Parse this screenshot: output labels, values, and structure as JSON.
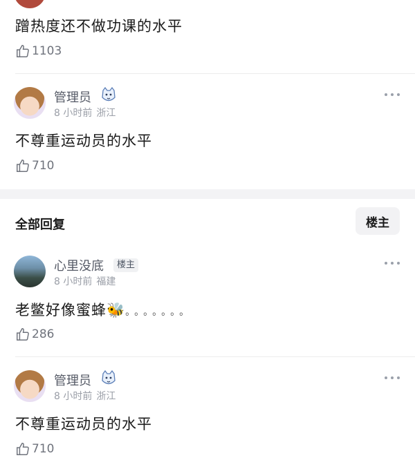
{
  "top_comment_partial": {
    "text": "蹭热度还不做功课的水平",
    "likes": "1103"
  },
  "comment_admin_1": {
    "username": "管理员",
    "time": "8 小时前",
    "location": "浙江",
    "text": "不尊重运动员的水平",
    "likes": "710"
  },
  "section": {
    "title": "全部回复",
    "owner_button": "楼主"
  },
  "reply_owner": {
    "username": "心里没底",
    "tag": "楼主",
    "time": "8 小时前",
    "location": "福建",
    "text": "老鳖好像蜜蜂🐝",
    "text_tail": "。。。。。。。",
    "likes": "286"
  },
  "reply_admin": {
    "username": "管理员",
    "time": "8 小时前",
    "location": "浙江",
    "text": "不尊重运动员的水平",
    "likes": "710"
  },
  "icons": {
    "like": "thumbs-up-icon",
    "more": "more-dots-icon",
    "badge": "cat-badge-icon"
  },
  "colors": {
    "divider": "#ececec",
    "muted": "#9a9ea7",
    "username": "#555a66"
  }
}
